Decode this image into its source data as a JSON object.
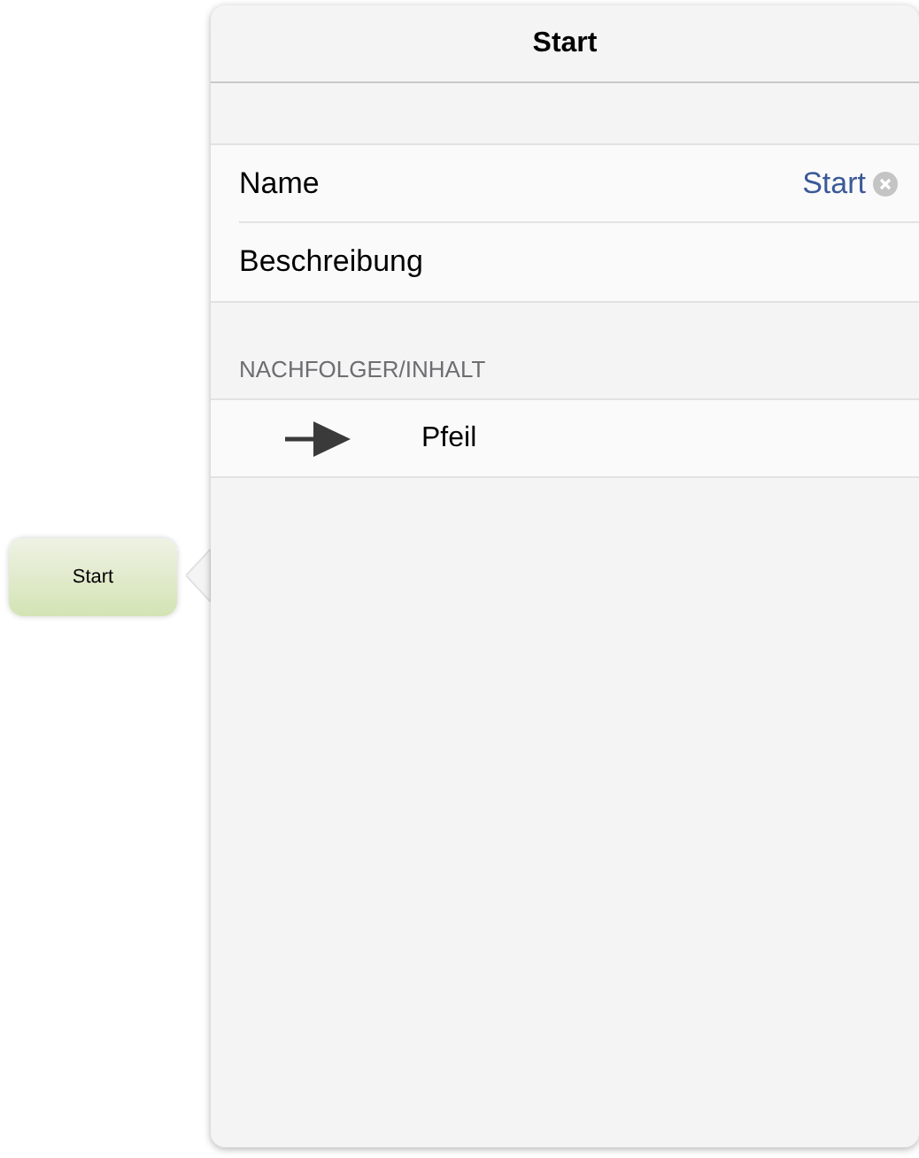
{
  "node": {
    "label": "Start"
  },
  "popover": {
    "title": "Start",
    "fields": [
      {
        "label": "Name",
        "value": "Start"
      },
      {
        "label": "Beschreibung"
      }
    ],
    "section": {
      "title": "NACHFOLGER/INHALT",
      "items": [
        {
          "label": "Pfeil"
        }
      ]
    }
  }
}
